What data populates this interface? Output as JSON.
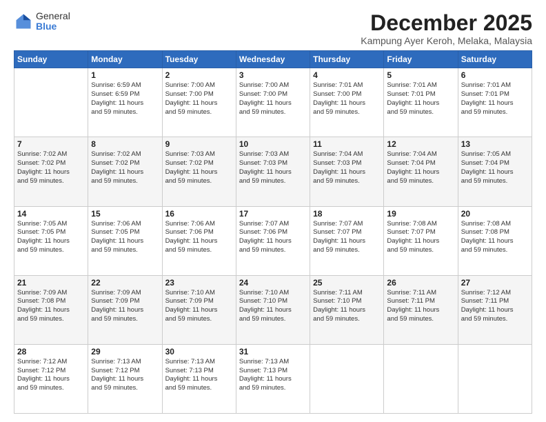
{
  "logo": {
    "general": "General",
    "blue": "Blue"
  },
  "title": "December 2025",
  "subtitle": "Kampung Ayer Keroh, Melaka, Malaysia",
  "weekdays": [
    "Sunday",
    "Monday",
    "Tuesday",
    "Wednesday",
    "Thursday",
    "Friday",
    "Saturday"
  ],
  "weeks": [
    [
      {
        "day": "",
        "info": ""
      },
      {
        "day": "1",
        "info": "Sunrise: 6:59 AM\nSunset: 6:59 PM\nDaylight: 11 hours\nand 59 minutes."
      },
      {
        "day": "2",
        "info": "Sunrise: 7:00 AM\nSunset: 7:00 PM\nDaylight: 11 hours\nand 59 minutes."
      },
      {
        "day": "3",
        "info": "Sunrise: 7:00 AM\nSunset: 7:00 PM\nDaylight: 11 hours\nand 59 minutes."
      },
      {
        "day": "4",
        "info": "Sunrise: 7:01 AM\nSunset: 7:00 PM\nDaylight: 11 hours\nand 59 minutes."
      },
      {
        "day": "5",
        "info": "Sunrise: 7:01 AM\nSunset: 7:01 PM\nDaylight: 11 hours\nand 59 minutes."
      },
      {
        "day": "6",
        "info": "Sunrise: 7:01 AM\nSunset: 7:01 PM\nDaylight: 11 hours\nand 59 minutes."
      }
    ],
    [
      {
        "day": "7",
        "info": "Sunrise: 7:02 AM\nSunset: 7:02 PM\nDaylight: 11 hours\nand 59 minutes."
      },
      {
        "day": "8",
        "info": "Sunrise: 7:02 AM\nSunset: 7:02 PM\nDaylight: 11 hours\nand 59 minutes."
      },
      {
        "day": "9",
        "info": "Sunrise: 7:03 AM\nSunset: 7:02 PM\nDaylight: 11 hours\nand 59 minutes."
      },
      {
        "day": "10",
        "info": "Sunrise: 7:03 AM\nSunset: 7:03 PM\nDaylight: 11 hours\nand 59 minutes."
      },
      {
        "day": "11",
        "info": "Sunrise: 7:04 AM\nSunset: 7:03 PM\nDaylight: 11 hours\nand 59 minutes."
      },
      {
        "day": "12",
        "info": "Sunrise: 7:04 AM\nSunset: 7:04 PM\nDaylight: 11 hours\nand 59 minutes."
      },
      {
        "day": "13",
        "info": "Sunrise: 7:05 AM\nSunset: 7:04 PM\nDaylight: 11 hours\nand 59 minutes."
      }
    ],
    [
      {
        "day": "14",
        "info": "Sunrise: 7:05 AM\nSunset: 7:05 PM\nDaylight: 11 hours\nand 59 minutes."
      },
      {
        "day": "15",
        "info": "Sunrise: 7:06 AM\nSunset: 7:05 PM\nDaylight: 11 hours\nand 59 minutes."
      },
      {
        "day": "16",
        "info": "Sunrise: 7:06 AM\nSunset: 7:06 PM\nDaylight: 11 hours\nand 59 minutes."
      },
      {
        "day": "17",
        "info": "Sunrise: 7:07 AM\nSunset: 7:06 PM\nDaylight: 11 hours\nand 59 minutes."
      },
      {
        "day": "18",
        "info": "Sunrise: 7:07 AM\nSunset: 7:07 PM\nDaylight: 11 hours\nand 59 minutes."
      },
      {
        "day": "19",
        "info": "Sunrise: 7:08 AM\nSunset: 7:07 PM\nDaylight: 11 hours\nand 59 minutes."
      },
      {
        "day": "20",
        "info": "Sunrise: 7:08 AM\nSunset: 7:08 PM\nDaylight: 11 hours\nand 59 minutes."
      }
    ],
    [
      {
        "day": "21",
        "info": "Sunrise: 7:09 AM\nSunset: 7:08 PM\nDaylight: 11 hours\nand 59 minutes."
      },
      {
        "day": "22",
        "info": "Sunrise: 7:09 AM\nSunset: 7:09 PM\nDaylight: 11 hours\nand 59 minutes."
      },
      {
        "day": "23",
        "info": "Sunrise: 7:10 AM\nSunset: 7:09 PM\nDaylight: 11 hours\nand 59 minutes."
      },
      {
        "day": "24",
        "info": "Sunrise: 7:10 AM\nSunset: 7:10 PM\nDaylight: 11 hours\nand 59 minutes."
      },
      {
        "day": "25",
        "info": "Sunrise: 7:11 AM\nSunset: 7:10 PM\nDaylight: 11 hours\nand 59 minutes."
      },
      {
        "day": "26",
        "info": "Sunrise: 7:11 AM\nSunset: 7:11 PM\nDaylight: 11 hours\nand 59 minutes."
      },
      {
        "day": "27",
        "info": "Sunrise: 7:12 AM\nSunset: 7:11 PM\nDaylight: 11 hours\nand 59 minutes."
      }
    ],
    [
      {
        "day": "28",
        "info": "Sunrise: 7:12 AM\nSunset: 7:12 PM\nDaylight: 11 hours\nand 59 minutes."
      },
      {
        "day": "29",
        "info": "Sunrise: 7:13 AM\nSunset: 7:12 PM\nDaylight: 11 hours\nand 59 minutes."
      },
      {
        "day": "30",
        "info": "Sunrise: 7:13 AM\nSunset: 7:13 PM\nDaylight: 11 hours\nand 59 minutes."
      },
      {
        "day": "31",
        "info": "Sunrise: 7:13 AM\nSunset: 7:13 PM\nDaylight: 11 hours\nand 59 minutes."
      },
      {
        "day": "",
        "info": ""
      },
      {
        "day": "",
        "info": ""
      },
      {
        "day": "",
        "info": ""
      }
    ]
  ]
}
